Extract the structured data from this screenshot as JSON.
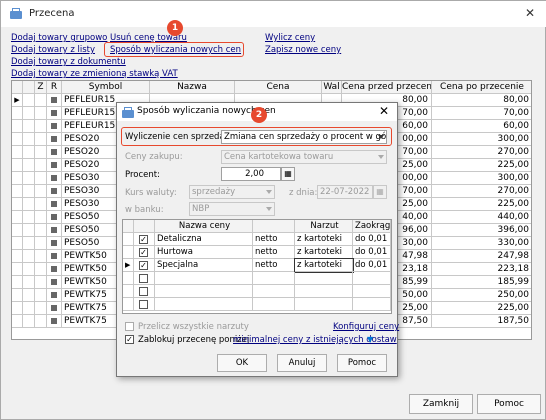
{
  "window": {
    "title": "Przecena"
  },
  "links": {
    "add_group": "Dodaj towary grupowo",
    "add_list": "Dodaj towary z listy",
    "add_document": "Dodaj towary z dokumentu",
    "add_vat": "Dodaj towary ze zmienioną stawką VAT",
    "remove_price": "Usuń cenę towaru",
    "calc_method": "Sposób wyliczania nowych cen",
    "calc_prices": "Wylicz ceny",
    "save_prices": "Zapisz nowe ceny"
  },
  "callouts": {
    "one": "1",
    "two": "2"
  },
  "grid": {
    "columns": [
      "Z",
      "R",
      "Symbol",
      "Nazwa",
      "Cena",
      "Wal",
      "Cena przed przecen",
      "Cena po przecenie"
    ],
    "rows": [
      {
        "symbol": "PEFLEUR15",
        "before": "80,00",
        "after": "80,00"
      },
      {
        "symbol": "PEFLEUR15",
        "before": "70,00",
        "after": "70,00"
      },
      {
        "symbol": "PEFLEUR15",
        "before": "60,00",
        "after": "60,00"
      },
      {
        "symbol": "PESO20",
        "before": "00,00",
        "after": "300,00"
      },
      {
        "symbol": "PESO20",
        "before": "70,00",
        "after": "270,00"
      },
      {
        "symbol": "PESO20",
        "before": "25,00",
        "after": "225,00"
      },
      {
        "symbol": "PESO30",
        "before": "00,00",
        "after": "300,00"
      },
      {
        "symbol": "PESO30",
        "before": "70,00",
        "after": "270,00"
      },
      {
        "symbol": "PESO30",
        "before": "25,00",
        "after": "225,00"
      },
      {
        "symbol": "PESO50",
        "before": "40,00",
        "after": "440,00"
      },
      {
        "symbol": "PESO50",
        "before": "96,00",
        "after": "396,00"
      },
      {
        "symbol": "PESO50",
        "before": "30,00",
        "after": "330,00"
      },
      {
        "symbol": "PEWTK50",
        "before": "47,98",
        "after": "247,98"
      },
      {
        "symbol": "PEWTK50",
        "before": "23,18",
        "after": "223,18"
      },
      {
        "symbol": "PEWTK50",
        "before": "85,99",
        "after": "185,99"
      },
      {
        "symbol": "PEWTK75",
        "before": "50,00",
        "after": "250,00"
      },
      {
        "symbol": "PEWTK75",
        "before": "25,00",
        "after": "225,00"
      },
      {
        "symbol": "PEWTK75",
        "before": "87,50",
        "after": "187,50"
      }
    ]
  },
  "buttons": {
    "close": "Zamknij",
    "help": "Pomoc"
  },
  "dialog": {
    "title": "Sposób wyliczania nowych cen",
    "calc_label": "Wyliczenie cen sprzedaży:",
    "calc_value": "Zmiana cen sprzedaży o procent w górę",
    "purchase_label": "Ceny zakupu:",
    "purchase_value": "Cena kartotekowa towaru",
    "percent_label": "Procent:",
    "percent_value": "2,00",
    "rate_label": "Kurs waluty:",
    "rate_value": "sprzedaży",
    "date_label": "z dnia:",
    "date_value": "22-07-2022",
    "bank_label": "w banku:",
    "bank_value": "NBP",
    "columns": {
      "name": "Nazwa ceny",
      "markup": "Narzut",
      "round": "Zaokrąglaj"
    },
    "rows": [
      {
        "name": "Detaliczna",
        "type": "netto",
        "markup": "z kartoteki",
        "round": "do 0,01 (n"
      },
      {
        "name": "Hurtowa",
        "type": "netto",
        "markup": "z kartoteki",
        "round": "do 0,01 (n"
      },
      {
        "name": "Specjalna",
        "type": "netto",
        "markup": "z kartoteki",
        "round": "do 0,01 (n"
      }
    ],
    "recalc_label": "Przelicz wszystkie narzuty",
    "configure_link": "Konfiguruj ceny",
    "block_label": "Zablokuj przecenę poniżej",
    "block_link": "minimalnej ceny z istniejących dostaw",
    "ok": "OK",
    "cancel": "Anuluj",
    "help": "Pomoc"
  },
  "colors": {
    "accent": "#e7492e",
    "link": "#000080",
    "window": "#f0f0f0",
    "selected": "#0078d7"
  }
}
